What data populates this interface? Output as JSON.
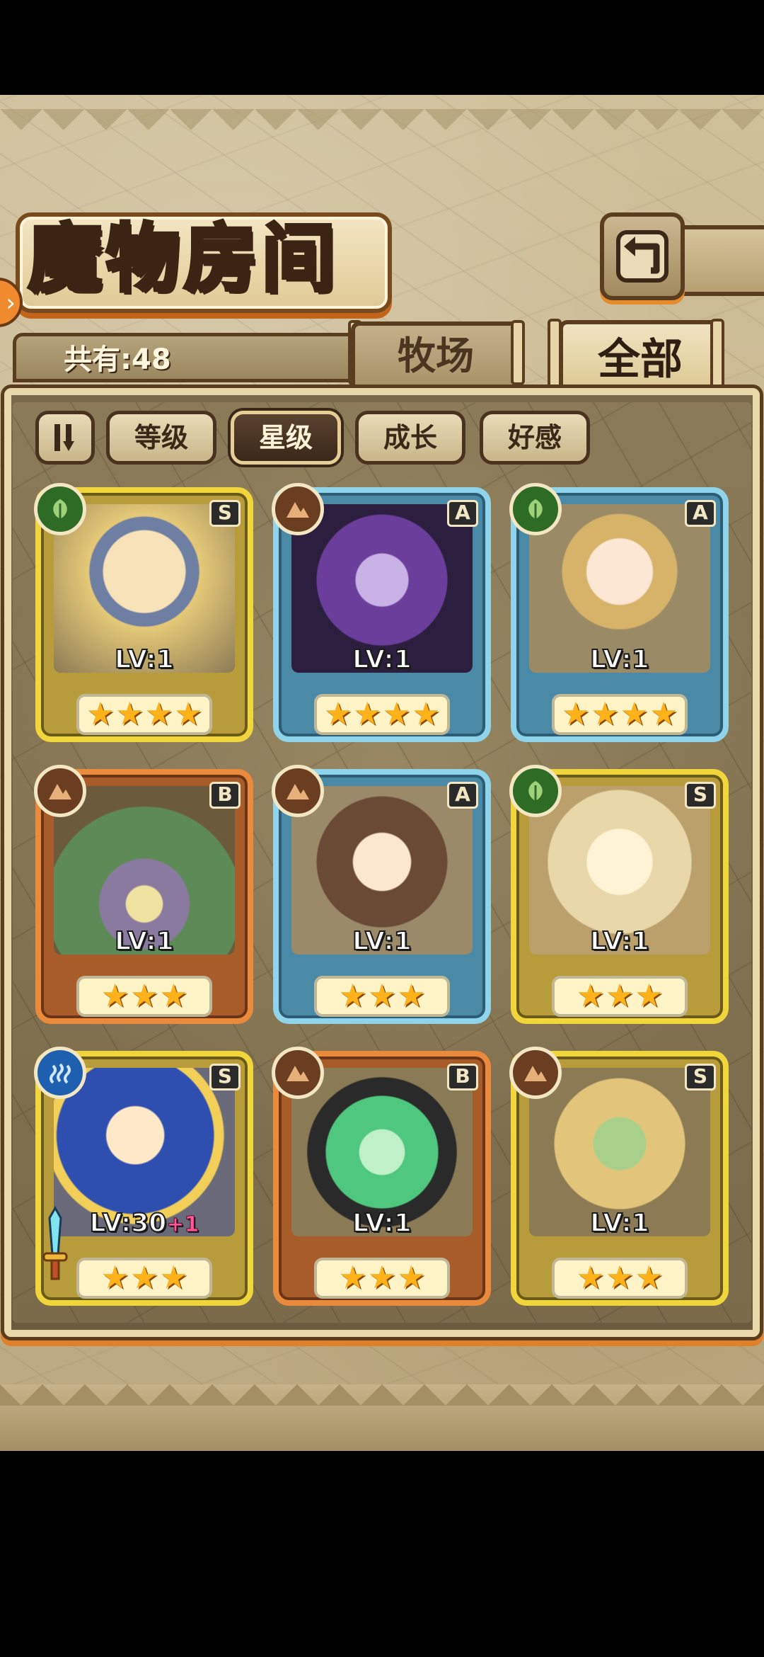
{
  "header": {
    "title": "魔物房间"
  },
  "counter": {
    "text": "共有:48"
  },
  "tabs": [
    {
      "label": "牧场",
      "selected": false
    },
    {
      "label": "全部",
      "selected": true
    }
  ],
  "filters": [
    {
      "label": "等级",
      "active": false
    },
    {
      "label": "星级",
      "active": true
    },
    {
      "label": "成长",
      "active": false
    },
    {
      "label": "好感",
      "active": false
    }
  ],
  "monsters": [
    {
      "rank": "S",
      "element": "nature-icon",
      "level": "LV:1",
      "stars": 4,
      "frame": "gold"
    },
    {
      "rank": "A",
      "element": "earth-icon",
      "level": "LV:1",
      "stars": 4,
      "frame": "blue"
    },
    {
      "rank": "A",
      "element": "nature-icon",
      "level": "LV:1",
      "stars": 4,
      "frame": "blue"
    },
    {
      "rank": "B",
      "element": "earth-icon",
      "level": "LV:1",
      "stars": 3,
      "frame": "orange"
    },
    {
      "rank": "A",
      "element": "earth-icon",
      "level": "LV:1",
      "stars": 3,
      "frame": "blue"
    },
    {
      "rank": "S",
      "element": "nature-icon",
      "level": "LV:1",
      "stars": 3,
      "frame": "gold"
    },
    {
      "rank": "S",
      "element": "water-icon",
      "level": "LV:30",
      "level_bonus": "+1",
      "stars": 3,
      "frame": "gold",
      "equipped": true
    },
    {
      "rank": "B",
      "element": "earth-icon",
      "level": "LV:1",
      "stars": 3,
      "frame": "orange"
    },
    {
      "rank": "S",
      "element": "earth-icon",
      "level": "LV:1",
      "stars": 3,
      "frame": "gold"
    }
  ],
  "colors": {
    "accent_orange": "#e0802a",
    "frame_dark": "#5a3d1f",
    "star": "#ffb21a"
  }
}
